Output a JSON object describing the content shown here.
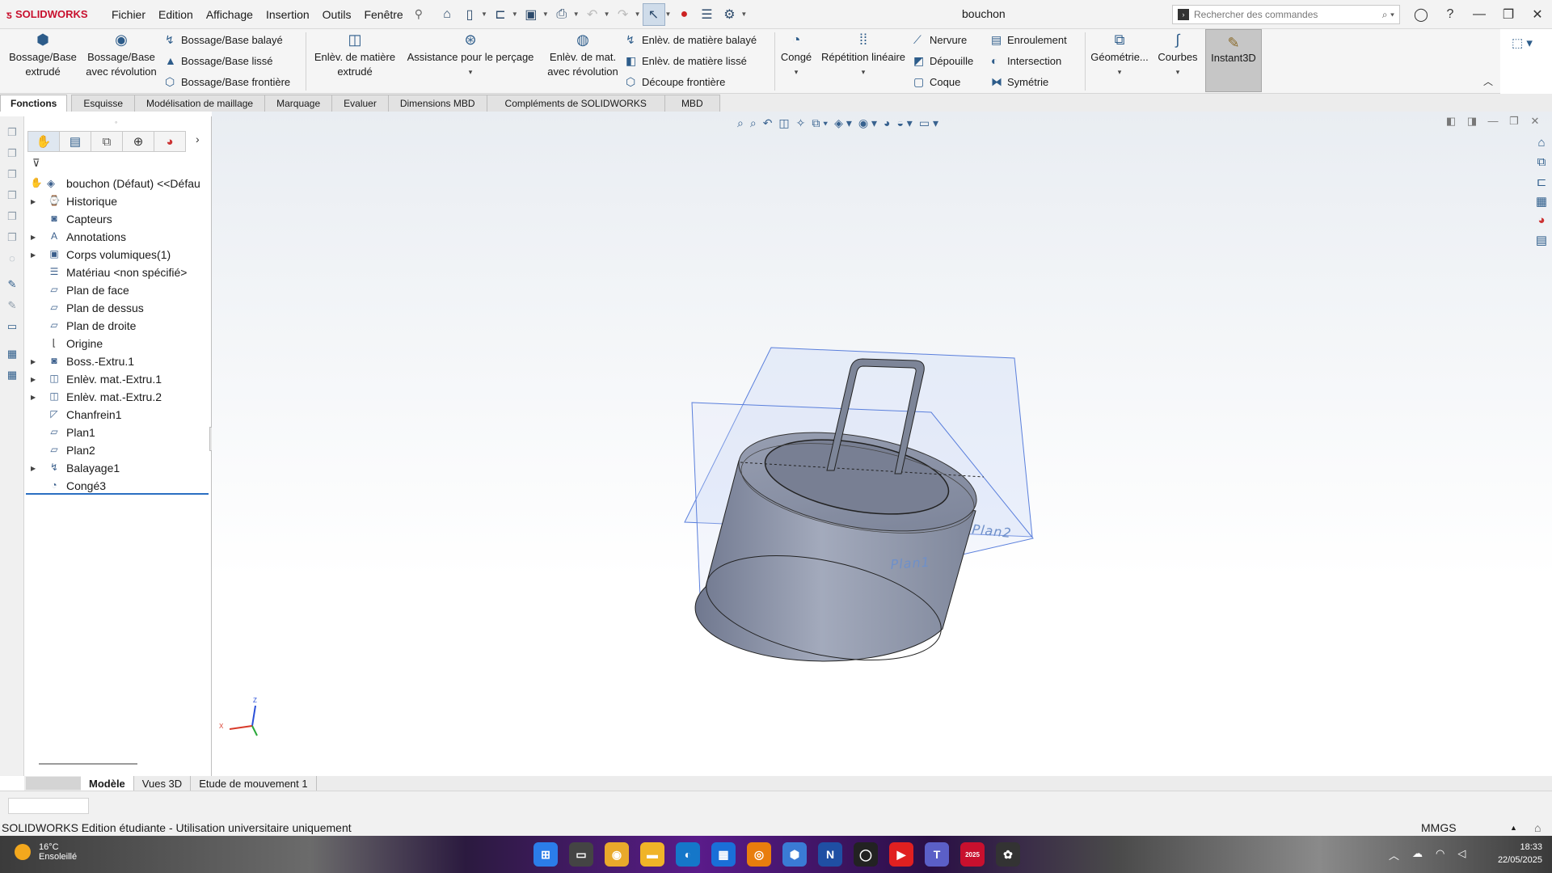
{
  "app": {
    "logo": "SOLIDWORKS",
    "document_title": "bouchon",
    "menu": [
      "Fichier",
      "Edition",
      "Affichage",
      "Insertion",
      "Outils",
      "Fenêtre"
    ],
    "search_placeholder": "Rechercher des commandes"
  },
  "ribbon": {
    "boss_extrude": "Bossage/Base extrudé",
    "boss_revolve": "Bossage/Base avec révolution",
    "boss_sweep": "Bossage/Base balayé",
    "boss_loft": "Bossage/Base lissé",
    "boss_boundary": "Bossage/Base frontière",
    "cut_extrude": "Enlèv. de matière extrudé",
    "hole_wizard": "Assistance pour le perçage",
    "cut_revolve": "Enlèv. de mat. avec révolution",
    "cut_sweep": "Enlèv. de matière balayé",
    "cut_loft": "Enlèv. de matière lissé",
    "cut_boundary": "Découpe frontière",
    "fillet": "Congé",
    "linear_pattern": "Répétition linéaire",
    "rib": "Nervure",
    "draft": "Dépouille",
    "shell": "Coque",
    "wrap": "Enroulement",
    "intersect": "Intersection",
    "mirror": "Symétrie",
    "reference_geometry": "Géométrie...",
    "curves": "Courbes",
    "instant3d": "Instant3D"
  },
  "command_tabs": [
    "Fonctions",
    "Esquisse",
    "Modélisation de maillage",
    "Marquage",
    "Evaluer",
    "Dimensions MBD",
    "Compléments de SOLIDWORKS",
    "MBD"
  ],
  "feature_tree": {
    "root": "bouchon (Défaut) <<Défau",
    "items": [
      {
        "label": "Historique",
        "expand": true,
        "icon": "history-icon"
      },
      {
        "label": "Capteurs",
        "expand": false,
        "icon": "sensors-icon"
      },
      {
        "label": "Annotations",
        "expand": true,
        "icon": "annotations-icon"
      },
      {
        "label": "Corps volumiques(1)",
        "expand": true,
        "icon": "solid-bodies-icon"
      },
      {
        "label": "Matériau <non spécifié>",
        "expand": false,
        "icon": "material-icon"
      },
      {
        "label": "Plan de face",
        "expand": false,
        "icon": "plane-icon"
      },
      {
        "label": "Plan de dessus",
        "expand": false,
        "icon": "plane-icon"
      },
      {
        "label": "Plan de droite",
        "expand": false,
        "icon": "plane-icon"
      },
      {
        "label": "Origine",
        "expand": false,
        "icon": "origin-icon"
      },
      {
        "label": "Boss.-Extru.1",
        "expand": true,
        "icon": "extrude-icon"
      },
      {
        "label": "Enlèv. mat.-Extru.1",
        "expand": true,
        "icon": "cut-extrude-icon"
      },
      {
        "label": "Enlèv. mat.-Extru.2",
        "expand": true,
        "icon": "cut-extrude-icon"
      },
      {
        "label": "Chanfrein1",
        "expand": false,
        "icon": "chamfer-icon"
      },
      {
        "label": "Plan1",
        "expand": false,
        "icon": "plane-icon"
      },
      {
        "label": "Plan2",
        "expand": false,
        "icon": "plane-icon"
      },
      {
        "label": "Balayage1",
        "expand": true,
        "icon": "sweep-icon"
      },
      {
        "label": "Congé3",
        "expand": false,
        "icon": "fillet-icon"
      }
    ]
  },
  "graphics": {
    "plane1_label": "Plan1",
    "plane2_label": "Plan2",
    "triad_x": "X",
    "triad_z": "Z",
    "colors": {
      "body": "#8f97ab",
      "plane_edge": "#5a7fdc",
      "plane_fill": "#c8d6f5"
    }
  },
  "bottom_tabs": [
    "Modèle",
    "Vues 3D",
    "Etude de mouvement 1"
  ],
  "status": {
    "left": "SOLIDWORKS Edition étudiante - Utilisation universitaire uniquement",
    "units": "MMGS"
  },
  "taskbar": {
    "temp": "16°C",
    "weather": "Ensoleillé",
    "time": "18:33",
    "date": "22/05/2025",
    "sw_badge": "2025"
  }
}
